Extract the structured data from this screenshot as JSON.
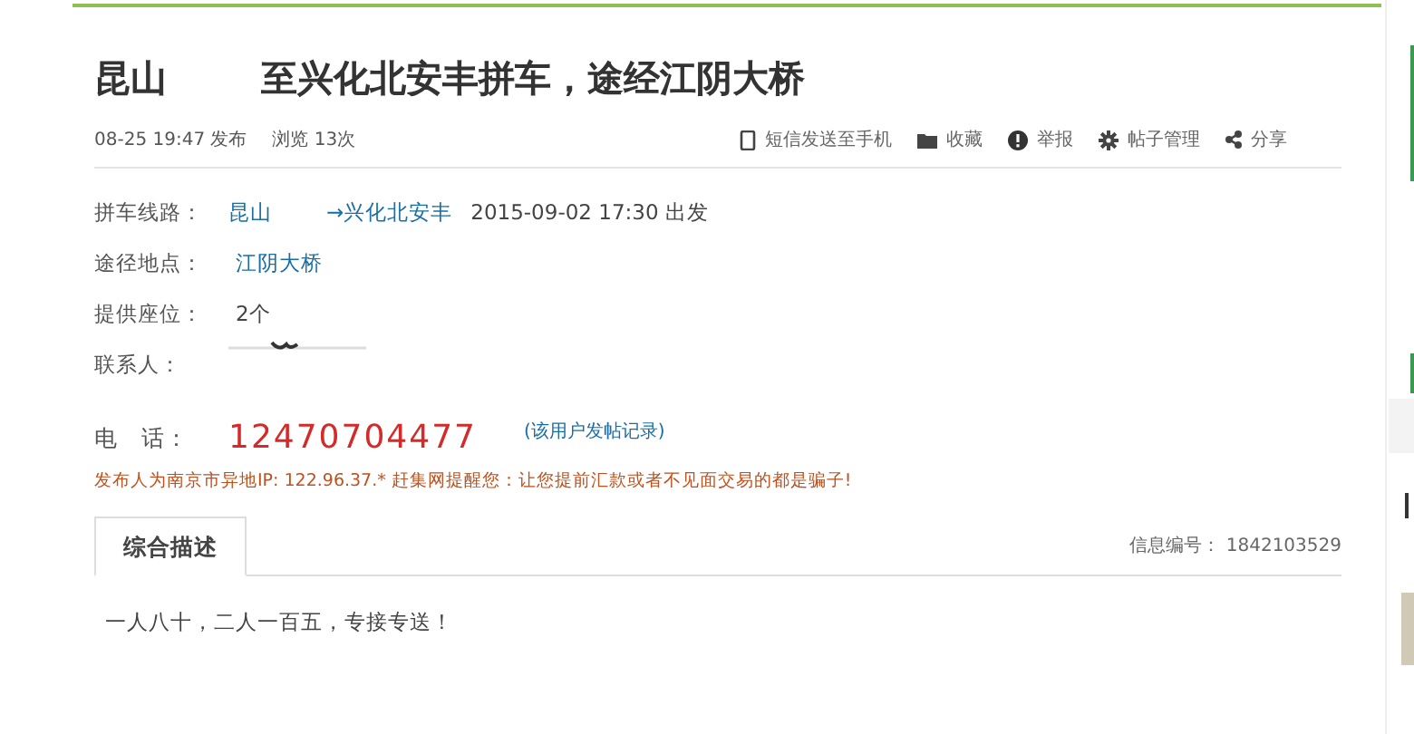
{
  "title": {
    "origin": "昆山",
    "rest": "至兴化北安丰拼车，途经江阴大桥"
  },
  "meta": {
    "posted": "08-25 19:47 发布",
    "views": "浏览  13次"
  },
  "actions": [
    {
      "kind": "phone",
      "label": "短信发送至手机"
    },
    {
      "kind": "folder",
      "label": "收藏"
    },
    {
      "kind": "alert",
      "label": "举报"
    },
    {
      "kind": "gear",
      "label": "帖子管理"
    },
    {
      "kind": "share",
      "label": "分享"
    }
  ],
  "details": [
    {
      "kind": "route",
      "label": "拼车线路：",
      "from": "昆山",
      "to": "→兴化北安丰",
      "time": "2015-09-02 17:30  出发"
    },
    {
      "kind": "link",
      "label": "途径地点：",
      "value": "江阴大桥"
    },
    {
      "kind": "text",
      "label": "提供座位：",
      "value": "2个"
    },
    {
      "kind": "contact",
      "label": "联系人："
    }
  ],
  "phone": {
    "label": "电　话：",
    "number": "12470704477",
    "history_link": "(该用户发帖记录)"
  },
  "warning": "发布人为南京市异地IP: 122.96.37.* 赶集网提醒您：让您提前汇款或者不见面交易的都是骗子!",
  "tabs": [
    {
      "label": "综合描述",
      "selected": true
    }
  ],
  "info_id": "信息编号：  1842103529",
  "description": "一人八十，二人一百五，专接专送！"
}
